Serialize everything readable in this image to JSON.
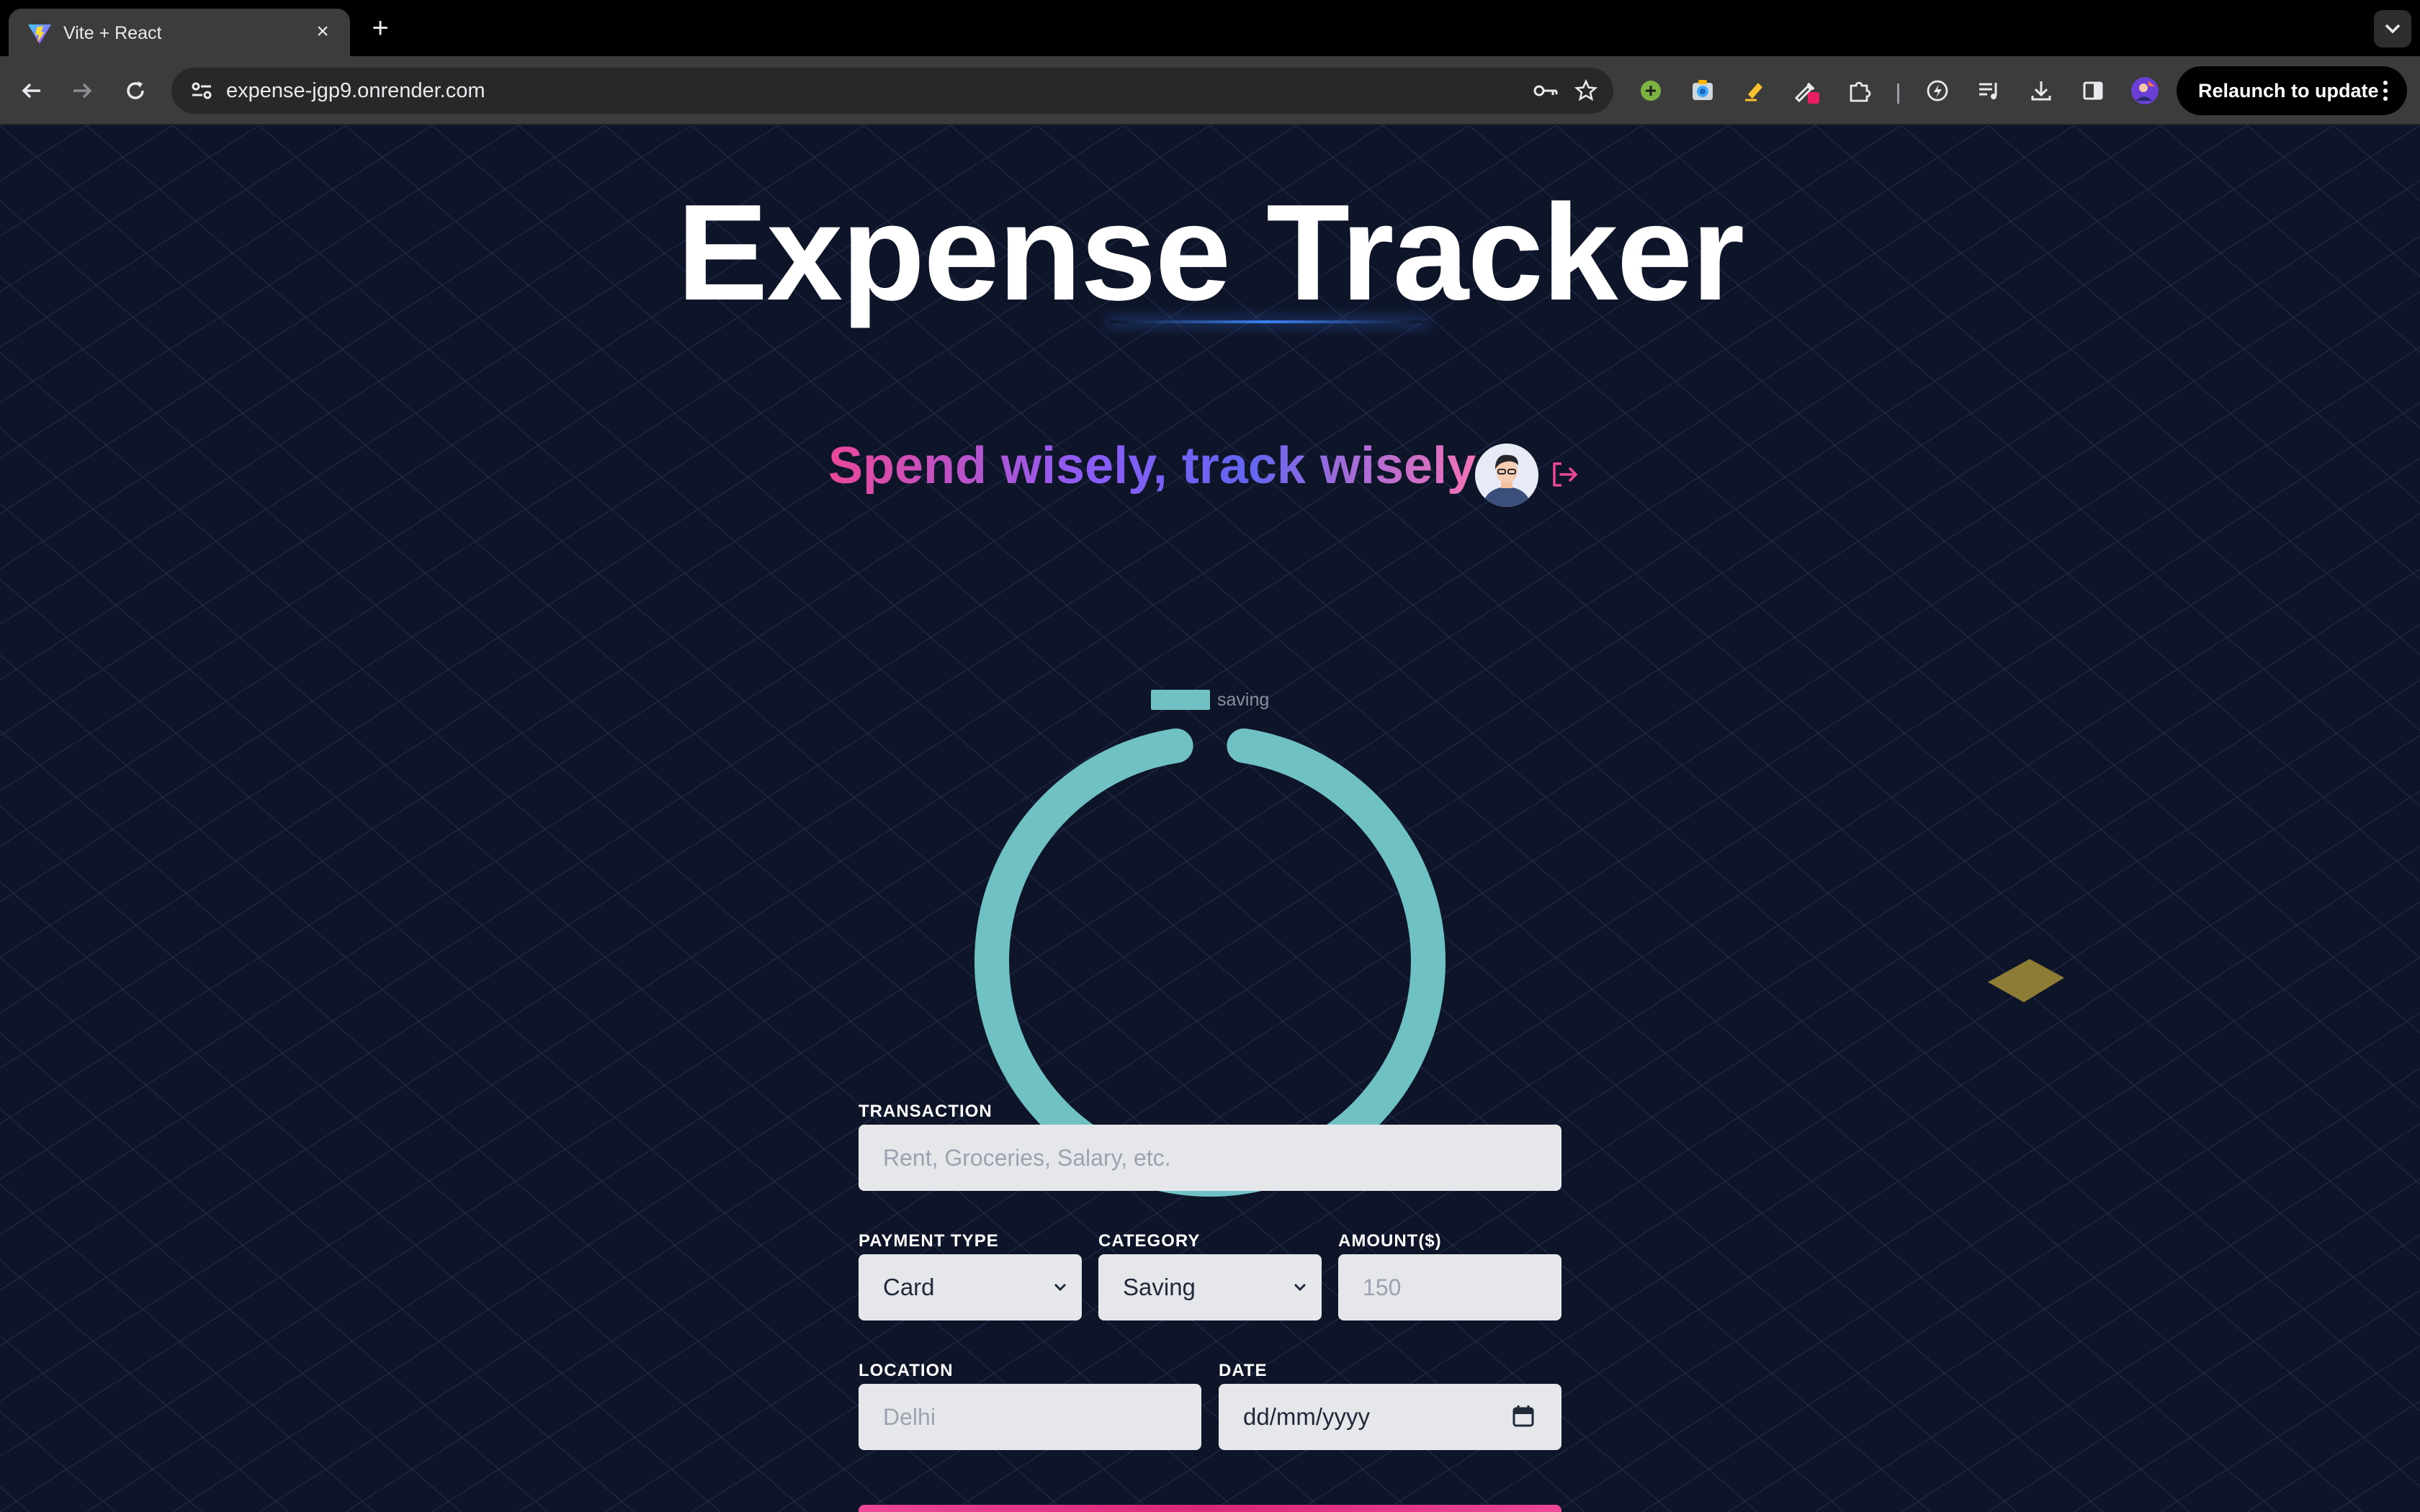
{
  "browser": {
    "tab_title": "Vite + React",
    "tab_close_icon": "×",
    "new_tab_icon": "+",
    "url": "expense-jgp9.onrender.com",
    "relaunch_label": "Relaunch to update"
  },
  "app": {
    "title": "Expense Tracker",
    "subtitle": "Spend wisely, track wisely"
  },
  "chart_data": {
    "type": "pie",
    "categories": [
      "saving"
    ],
    "values": [
      150
    ],
    "colors": [
      "#6fc1c3"
    ],
    "legend_position": "top",
    "legend_label": "saving",
    "style": "doughnut"
  },
  "form": {
    "transaction_label": "TRANSACTION",
    "transaction_placeholder": "Rent, Groceries, Salary, etc.",
    "payment_type_label": "PAYMENT TYPE",
    "payment_type_value": "Card",
    "category_label": "CATEGORY",
    "category_value": "Saving",
    "amount_label": "AMOUNT($)",
    "amount_placeholder": "150",
    "location_label": "LOCATION",
    "location_placeholder": "Delhi",
    "date_label": "DATE",
    "date_value": "dd/mm/yyyy"
  },
  "colors": {
    "background": "#0f1529",
    "accent_teal": "#6fc1c3",
    "accent_pink": "#ec4899",
    "accent_purple": "#8b5cf6"
  }
}
